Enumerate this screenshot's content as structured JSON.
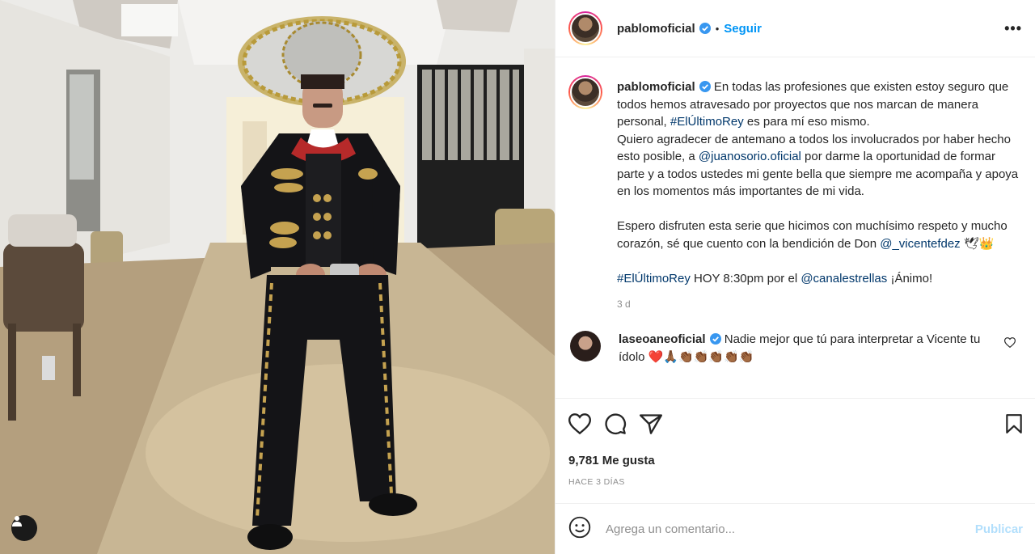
{
  "post": {
    "username": "pablomoficial",
    "follow_label": "Seguir",
    "dot": "•",
    "more_label": "•••"
  },
  "caption": {
    "username": "pablomoficial",
    "p1_a": "En todas las profesiones que existen estoy seguro que todos hemos atravesado por proyectos que nos marcan de manera personal, ",
    "p1_tag": "#ElÚltimoRey",
    "p1_b": " es para mí eso mismo.",
    "p2_a": "Quiero agradecer de antemano a todos los involucrados por haber hecho esto posible, a ",
    "p2_mention": "@juanosorio.oficial",
    "p2_b": " por darme la oportunidad de formar parte y a todos ustedes mi gente bella que siempre me acompaña y apoya en los momentos más importantes de mi vida.",
    "p3_a": "Espero disfruten esta serie que hicimos con muchísimo respeto y mucho corazón, sé que cuento con la bendición de Don ",
    "p3_mention": "@_vicentefdez",
    "p3_emoji": " 🕊👑",
    "p4_tag": "#ElÚltimoRey",
    "p4_a": " HOY 8:30pm por el ",
    "p4_mention": "@canalestrellas",
    "p4_b": " ¡Ánimo!",
    "time": "3 d"
  },
  "comment": {
    "username": "laseoaneoficial",
    "text": " Nadie mejor que tú para interpretar a Vicente tu ídolo ",
    "emoji": "❤️🙏🏾👏🏾👏🏾👏🏾👏🏾👏🏾"
  },
  "actions": {
    "likes": "9,781 Me gusta",
    "ago": "HACE 3 DÍAS"
  },
  "add_comment": {
    "placeholder": "Agrega un comentario...",
    "publish": "Publicar"
  },
  "colors": {
    "link": "#00376b",
    "follow": "#0095f6",
    "publish_disabled": "#b2dffc",
    "verified": "#3897f0"
  }
}
